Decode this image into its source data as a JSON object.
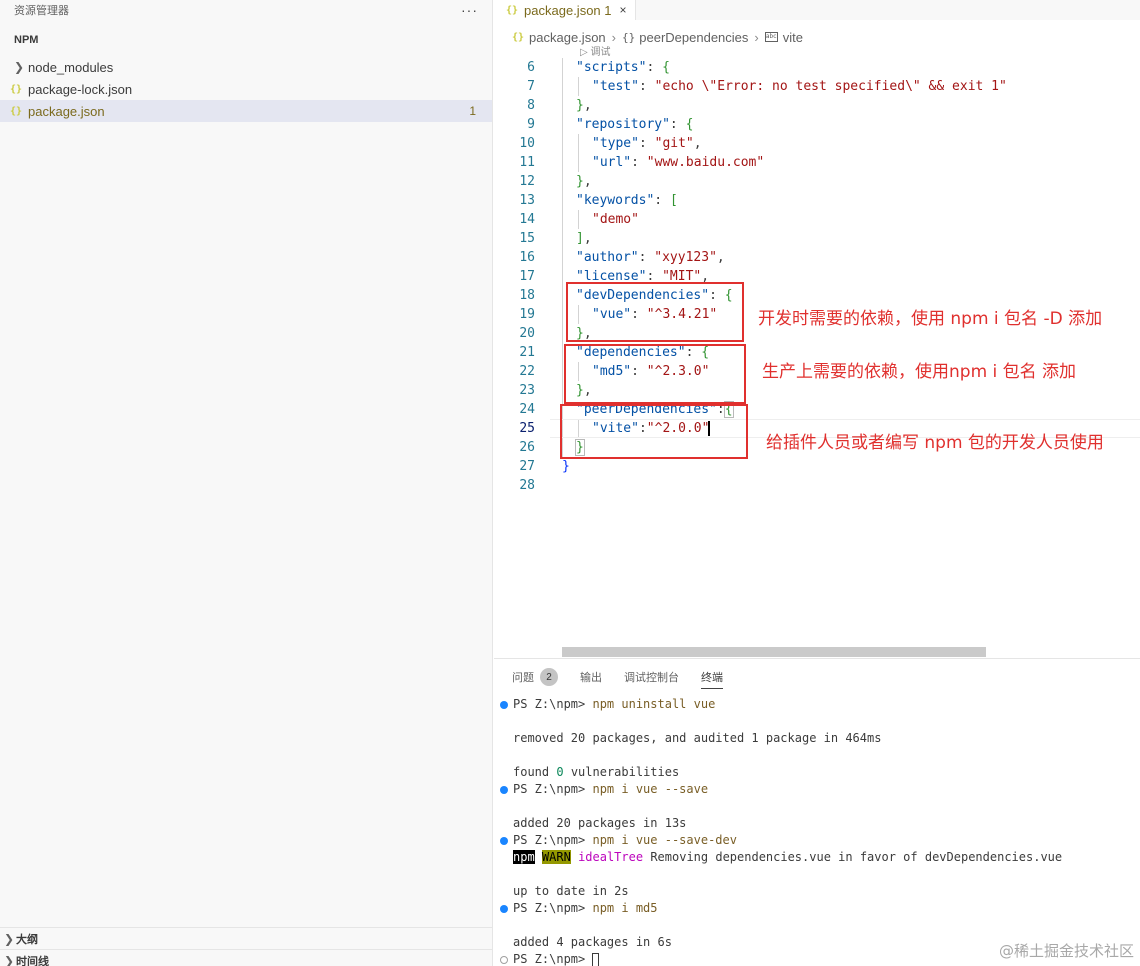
{
  "sidebar": {
    "title": "资源管理器",
    "more": "···",
    "section": "NPM",
    "items": [
      {
        "label": "node_modules",
        "icon": "chevron-right-icon"
      },
      {
        "label": "package-lock.json",
        "icon": "json-icon"
      },
      {
        "label": "package.json",
        "icon": "json-icon",
        "badge": "1"
      }
    ],
    "bottom": [
      {
        "label": "大纲"
      },
      {
        "label": "时间线"
      }
    ]
  },
  "editor": {
    "tab": {
      "icon_text": "{}",
      "label": "package.json 1",
      "close": "×"
    },
    "breadcrumbs": [
      "package.json",
      "peerDependencies",
      "vite"
    ],
    "codelens": "▷ 调试",
    "lines": [
      {
        "n": "6"
      },
      {
        "n": "7"
      },
      {
        "n": "8"
      },
      {
        "n": "9"
      },
      {
        "n": "10"
      },
      {
        "n": "11"
      },
      {
        "n": "12"
      },
      {
        "n": "13"
      },
      {
        "n": "14"
      },
      {
        "n": "15"
      },
      {
        "n": "16"
      },
      {
        "n": "17"
      },
      {
        "n": "18"
      },
      {
        "n": "19"
      },
      {
        "n": "20"
      },
      {
        "n": "21"
      },
      {
        "n": "22"
      },
      {
        "n": "23"
      },
      {
        "n": "24"
      },
      {
        "n": "25"
      },
      {
        "n": "26"
      },
      {
        "n": "27"
      },
      {
        "n": "28"
      }
    ],
    "code": {
      "scripts_key": "\"scripts\"",
      "test_key": "\"test\"",
      "test_val": "\"echo \\\"Error: no test specified\\\" && exit 1\"",
      "repository_key": "\"repository\"",
      "type_key": "\"type\"",
      "type_val": "\"git\"",
      "url_key": "\"url\"",
      "url_val": "\"www.baidu.com\"",
      "keywords_key": "\"keywords\"",
      "demo_val": "\"demo\"",
      "author_key": "\"author\"",
      "author_val": "\"xyy123\"",
      "license_key": "\"license\"",
      "license_val": "\"MIT\"",
      "devdeps_key": "\"devDependencies\"",
      "vue_key": "\"vue\"",
      "vue_val": "\"^3.4.21\"",
      "deps_key": "\"dependencies\"",
      "md5_key": "\"md5\"",
      "md5_val": "\"^2.3.0\"",
      "peer_key": "\"peerDependencies\"",
      "vite_key": "\"vite\"",
      "vite_val": "\"^2.0.0\""
    },
    "annotations": [
      "开发时需要的依赖，使用 npm i 包名 -D 添加",
      "生产上需要的依赖，使用npm i 包名 添加",
      "给插件人员或者编写 npm 包的开发人员使用"
    ]
  },
  "panel": {
    "tabs": [
      {
        "label": "问题",
        "count": "2"
      },
      {
        "label": "输出"
      },
      {
        "label": "调试控制台"
      },
      {
        "label": "终端",
        "active": true
      }
    ],
    "terminal": {
      "prompt": "PS Z:\\npm> ",
      "cmd1": "npm uninstall vue",
      "out1": "removed 20 packages, and audited 1 package in 464ms",
      "out2a": "found ",
      "out2n": "0",
      "out2b": " vulnerabilities",
      "cmd2": "npm i vue --save",
      "out3": "added 20 packages in 13s",
      "cmd3": "npm i vue --save-dev",
      "npm_tag": "npm",
      "warn_tag": "WARN",
      "warn_src": "idealTree",
      "warn_msg": " Removing dependencies.vue in favor of devDependencies.vue",
      "out4": "up to date in 2s",
      "cmd4": "npm i md5",
      "out5": "added 4 packages in 6s"
    }
  },
  "watermark": "@稀土掘金技术社区",
  "colors": {
    "annotation": "#e0302e",
    "json_key": "#0451a5",
    "json_string": "#a31515",
    "line_number": "#237893"
  }
}
